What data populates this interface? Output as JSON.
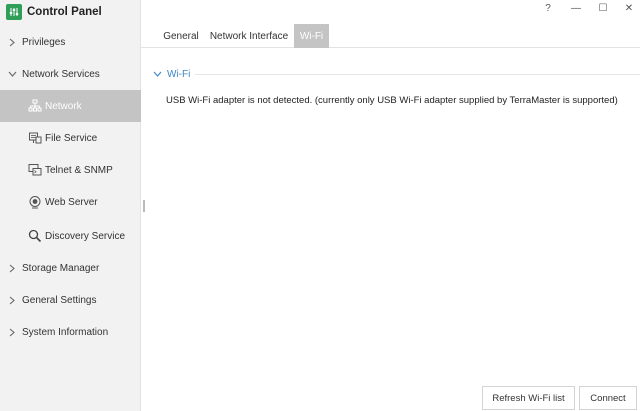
{
  "app": {
    "title": "Control Panel"
  },
  "window_controls": {
    "help": "?",
    "minimize": "—",
    "maximize": "☐",
    "close": "✕"
  },
  "sidebar": {
    "items": [
      {
        "label": "Privileges"
      },
      {
        "label": "Network Services"
      },
      {
        "label": "Storage Manager"
      },
      {
        "label": "General Settings"
      },
      {
        "label": "System Information"
      }
    ],
    "network_services": [
      {
        "label": "Network"
      },
      {
        "label": "File Service"
      },
      {
        "label": "Telnet & SNMP"
      },
      {
        "label": "Web Server"
      },
      {
        "label": "Discovery Service"
      }
    ]
  },
  "tabs": [
    {
      "label": "General"
    },
    {
      "label": "Network Interface"
    },
    {
      "label": "Wi-Fi"
    }
  ],
  "wifi": {
    "section_title": "Wi-Fi",
    "message": "USB Wi-Fi adapter is not detected. (currently only USB Wi-Fi adapter supplied by TerraMaster is supported)"
  },
  "buttons": {
    "refresh": "Refresh Wi-Fi list",
    "connect": "Connect"
  },
  "colors": {
    "brand": "#2f9e57",
    "accent": "#3d86c6",
    "selected": "#c4c4c4"
  }
}
